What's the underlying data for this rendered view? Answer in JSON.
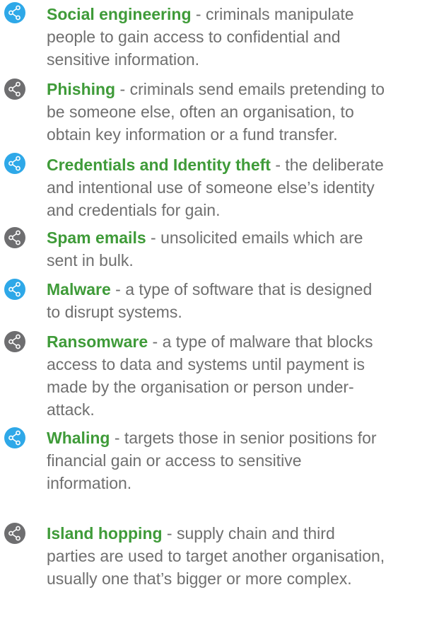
{
  "colors": {
    "term": "#3f9b39",
    "body_text": "#6f6f6f",
    "bullet_blue": "#2ea8e8",
    "bullet_grey": "#6e6e70"
  },
  "icon": "share-icon",
  "items": [
    {
      "term": "Social engineering",
      "bullet": "blue",
      "lines": [
        " - criminals manipulate",
        "people to gain access to confidential and",
        "sensitive information."
      ]
    },
    {
      "term": "Phishing",
      "bullet": "grey",
      "lines": [
        " - criminals send emails pretending to",
        "be someone else, often an organisation, to",
        "obtain key information or a fund transfer."
      ]
    },
    {
      "term": "Credentials and Identity theft",
      "bullet": "blue",
      "lines": [
        " - the deliberate",
        "and intentional use of someone else’s identity",
        "and credentials for gain."
      ]
    },
    {
      "term": "Spam emails",
      "bullet": "grey",
      "lines": [
        " - unsolicited emails which are",
        "sent in bulk."
      ]
    },
    {
      "term": "Malware",
      "bullet": "blue",
      "lines": [
        " - a type of software that is designed",
        "to disrupt systems."
      ]
    },
    {
      "term": "Ransomware",
      "bullet": "grey",
      "lines": [
        " - a type of malware that blocks",
        "access to data and systems until payment is",
        "made by the organisation or person under-",
        "attack."
      ]
    },
    {
      "term": "Whaling",
      "bullet": "blue",
      "lines": [
        " - targets those in senior positions for",
        "financial gain or access to sensitive",
        "information."
      ]
    },
    {
      "term": "Island hopping",
      "bullet": "grey",
      "lines": [
        " - supply chain and third",
        "parties are used to target another organisation,",
        "usually one that’s bigger or more complex."
      ]
    }
  ]
}
